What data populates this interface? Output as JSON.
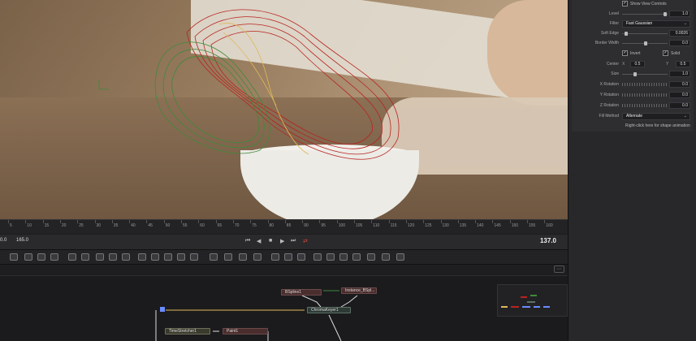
{
  "viewer": {
    "title": ""
  },
  "timeline": {
    "ruler_labels": [
      "5",
      "10",
      "15",
      "20",
      "25",
      "30",
      "35",
      "40",
      "45",
      "50",
      "55",
      "60",
      "65",
      "70",
      "75",
      "80",
      "85",
      "90",
      "95",
      "100",
      "105",
      "110",
      "115",
      "120",
      "125",
      "130",
      "135",
      "140",
      "145",
      "150",
      "155",
      "160"
    ],
    "start_frame": "0.0",
    "end_frame": "165.0",
    "current_frame": "137.0"
  },
  "transport": {
    "go_start": "⏮",
    "play_reverse": "◀",
    "stop": "■",
    "play": "▶",
    "go_end": "⏭",
    "loop": "⇄"
  },
  "nodes": {
    "bspline": "BSpline1",
    "instance": "Instance_BSpl...",
    "chromakeyer": "ChromaKeyer1",
    "timestretcher": "TimeStretcher1",
    "paint": "Paint1",
    "more_button": "···"
  },
  "inspector": {
    "show_view_controls": "Show View Controls",
    "level_label": "Level",
    "level_value": "1.0",
    "level_fraction": 0.95,
    "filter_label": "Filter",
    "filter_value": "Fast Gaussian",
    "soft_edge_label": "Soft Edge",
    "soft_edge_value": "0.0026",
    "soft_edge_fraction": 0.05,
    "border_width_label": "Border Width",
    "border_width_value": "0.0",
    "border_width_fraction": 0.5,
    "invert_label": "Invert",
    "solid_label": "Solid",
    "center_label": "Center",
    "center_x_label": "X",
    "center_x_value": "0.5",
    "center_y_label": "Y",
    "center_y_value": "0.5",
    "size_label": "Size",
    "size_value": "1.0",
    "size_fraction": 0.25,
    "x_rotation_label": "X Rotation",
    "x_rotation_value": "0.0",
    "y_rotation_label": "Y Rotation",
    "y_rotation_value": "0.0",
    "z_rotation_label": "Z Rotation",
    "z_rotation_value": "0.0",
    "fill_method_label": "Fill Method",
    "fill_method_value": "Alternate",
    "hint": "Right-click here for shape animation"
  },
  "colors": {
    "accent": "#e0b85a",
    "spline_red": "#b8231f",
    "spline_green": "#3f8a3a",
    "loop_active": "#e0463c"
  }
}
